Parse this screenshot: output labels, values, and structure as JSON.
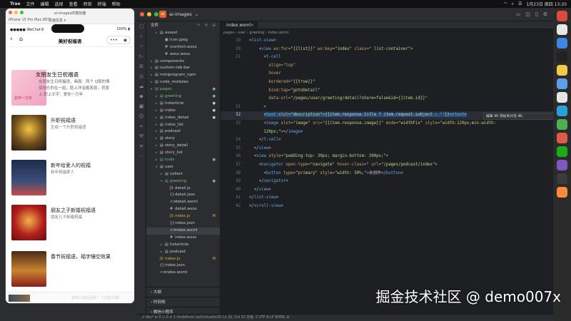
{
  "menubar": {
    "app_name": "Trae",
    "menus": [
      "文件",
      "编辑",
      "选择",
      "查看",
      "转到",
      "终端",
      "帮助"
    ],
    "clock": "1月23日 周四 13:20"
  },
  "simulator": {
    "window_title": "ai-images的模拟器",
    "device_label": "iPhone 15 Pro Max 85%",
    "tag_label": "页面信息 ▾",
    "carrier": "●●●●● WeChat令",
    "battery": "100% ▮",
    "nav_title": "美好祝福语",
    "capsule_dots": "•••",
    "capsule_circle": "◉",
    "hero": {
      "title": "女朋友生日祝福语",
      "desc_line1": "女朋友生日祝福语，画面：两个 Q版的情",
      "desc_line2": "侣快乐的在一起，脸上洋溢着笑容，背景",
      "desc_line3": "上 配上文字：爱你一万年",
      "thumb_text": "爱你一万年"
    },
    "cards": [
      {
        "title": "升职祝福语",
        "subtitle": "生成一个升职祝福语"
      },
      {
        "title": "新年给爱人的祝福",
        "subtitle": "新年祝福爱人"
      },
      {
        "title": "朋友之子新婚祝福语",
        "subtitle": "朋友儿子新婚祝福"
      },
      {
        "title": "春节祝福语，福字镶空效果",
        "subtitle": ""
      }
    ],
    "bottom_text": "送啥心流派武将！《斗笠江湖》"
  },
  "ide": {
    "project_name": "ai-images",
    "explorer_title": "文件",
    "tab_name": "index.wxml",
    "breadcrumb": "pages  ›  user  ›  greeting  ›  index.wxml",
    "footer_outline": "大纲",
    "footer_timeline": "时间线",
    "footer_mini": "微信小程序",
    "status": "⎇ dev*  ⊗ 0 ⚠ 0        ⊘ 1  Undefined (es5/cloud/es5)       Ln 32, Col 32   空格: 2   UTF-8   LF   WXML   ⚙",
    "popup_text": "编辑  ⌘I  添加到对话  ⌘L",
    "tree": [
      {
        "indent": 1,
        "arrow": "▸",
        "icon": "▤",
        "name": "assest",
        "flag": "",
        "cls": ""
      },
      {
        "indent": 2,
        "arrow": "",
        "icon": "▣",
        "name": "icon.jpeg",
        "flag": "",
        "cls": ""
      },
      {
        "indent": 2,
        "arrow": "",
        "icon": "#",
        "name": "iconfont.wxss",
        "flag": "",
        "cls": ""
      },
      {
        "indent": 2,
        "arrow": "",
        "icon": "#",
        "name": "weui.wxss",
        "flag": "",
        "cls": ""
      },
      {
        "indent": 0,
        "arrow": "▸",
        "icon": "▤",
        "name": "components",
        "flag": "",
        "cls": ""
      },
      {
        "indent": 0,
        "arrow": "▸",
        "icon": "▤",
        "name": "custom-tab-bar",
        "flag": "",
        "cls": ""
      },
      {
        "indent": 0,
        "arrow": "▸",
        "icon": "▤",
        "name": "miniprogram_npm",
        "flag": "",
        "cls": ""
      },
      {
        "indent": 0,
        "arrow": "▸",
        "icon": "▤",
        "name": "node_modules",
        "flag": "",
        "cls": ""
      },
      {
        "indent": 0,
        "arrow": "▾",
        "icon": "▤",
        "name": "pages",
        "flag": "●",
        "cls": "green"
      },
      {
        "indent": 1,
        "arrow": "▸",
        "icon": "▤",
        "name": "greeting",
        "flag": "●",
        "cls": "green"
      },
      {
        "indent": 1,
        "arrow": "▸",
        "icon": "▤",
        "name": "hotarticle",
        "flag": "●",
        "cls": ""
      },
      {
        "indent": 1,
        "arrow": "▸",
        "icon": "▤",
        "name": "index",
        "flag": "●",
        "cls": ""
      },
      {
        "indent": 1,
        "arrow": "▸",
        "icon": "▤",
        "name": "index_detail",
        "flag": "●",
        "cls": ""
      },
      {
        "indent": 1,
        "arrow": "▸",
        "icon": "▤",
        "name": "index_list",
        "flag": "",
        "cls": ""
      },
      {
        "indent": 1,
        "arrow": "▸",
        "icon": "▤",
        "name": "podcast",
        "flag": "",
        "cls": ""
      },
      {
        "indent": 1,
        "arrow": "▸",
        "icon": "▤",
        "name": "story",
        "flag": "",
        "cls": ""
      },
      {
        "indent": 1,
        "arrow": "▸",
        "icon": "▤",
        "name": "story_detail",
        "flag": "",
        "cls": ""
      },
      {
        "indent": 1,
        "arrow": "▸",
        "icon": "▤",
        "name": "story_list",
        "flag": "",
        "cls": ""
      },
      {
        "indent": 1,
        "arrow": "▸",
        "icon": "▤",
        "name": "tools",
        "flag": "●",
        "cls": "green"
      },
      {
        "indent": 1,
        "arrow": "▾",
        "icon": "▤",
        "name": "user",
        "flag": "",
        "cls": ""
      },
      {
        "indent": 2,
        "arrow": "▸",
        "icon": "▤",
        "name": "collect",
        "flag": "",
        "cls": ""
      },
      {
        "indent": 2,
        "arrow": "▾",
        "icon": "▤",
        "name": "greeting",
        "flag": "●",
        "cls": "green"
      },
      {
        "indent": 3,
        "arrow": "",
        "icon": "JS",
        "name": "detail.js",
        "flag": "",
        "cls": ""
      },
      {
        "indent": 3,
        "arrow": "",
        "icon": "{}",
        "name": "detail.json",
        "flag": "",
        "cls": ""
      },
      {
        "indent": 3,
        "arrow": "",
        "icon": "<>",
        "name": "detail.wxml",
        "flag": "",
        "cls": ""
      },
      {
        "indent": 3,
        "arrow": "",
        "icon": "#",
        "name": "detail.wxss",
        "flag": "",
        "cls": ""
      },
      {
        "indent": 3,
        "arrow": "",
        "icon": "JS",
        "name": "index.js",
        "flag": "M",
        "cls": "yellow"
      },
      {
        "indent": 3,
        "arrow": "",
        "icon": "{}",
        "name": "index.json",
        "flag": "",
        "cls": ""
      },
      {
        "indent": 3,
        "arrow": "",
        "icon": "<>",
        "name": "index.wxml",
        "flag": "",
        "cls": "sel"
      },
      {
        "indent": 3,
        "arrow": "",
        "icon": "#",
        "name": "index.wxss",
        "flag": "",
        "cls": ""
      },
      {
        "indent": 2,
        "arrow": "▸",
        "icon": "▤",
        "name": "hotarticle",
        "flag": "",
        "cls": ""
      },
      {
        "indent": 2,
        "arrow": "▸",
        "icon": "▤",
        "name": "podcast",
        "flag": "",
        "cls": ""
      },
      {
        "indent": 1,
        "arrow": "",
        "icon": "JS",
        "name": "index.js",
        "flag": "M",
        "cls": "yellow"
      },
      {
        "indent": 1,
        "arrow": "",
        "icon": "{}",
        "name": "index.json",
        "flag": "",
        "cls": ""
      },
      {
        "indent": 1,
        "arrow": "",
        "icon": "<>",
        "name": "index.wxml",
        "flag": "",
        "cls": ""
      }
    ],
    "code": [
      {
        "n": "19",
        "html": "<span class='punc'>&lt;</span><span class='tag'>list-view</span><span class='punc'>&gt;</span>"
      },
      {
        "n": "20",
        "html": "    <span class='punc'>&lt;</span><span class='tag'>view</span> <span class='attr'>wx:for</span><span class='punc'>=</span><span class='str'>\"{{list}}\"</span> <span class='attr'>wx:key</span><span class='punc'>=</span><span class='str'>\"index\"</span> <span class='attr'>class</span><span class='punc'>=</span><span class='str'>\" list-container\"</span><span class='punc'>&gt;</span>"
      },
      {
        "n": "21",
        "html": "      <span class='punc'>&lt;</span><span class='tag'>t-cell</span>"
      },
      {
        "n": "",
        "html": "        <span class='attr'>align=\"top\"</span>"
      },
      {
        "n": "",
        "html": "        <span class='attr'>hover</span>"
      },
      {
        "n": "",
        "html": "        <span class='attr'>bordered</span><span class='punc'>=</span><span class='str'>\"{{true}}\"</span>"
      },
      {
        "n": "",
        "html": "        <span class='attr'>bind:tap</span><span class='punc'>=</span><span class='str'>\"gotoDetail\"</span>"
      },
      {
        "n": "",
        "html": "        <span class='attr'>data-url</span><span class='punc'>=</span><span class='str'>\"/pages/user/greeting/detail?share=false&amp;id={{item.id}}\"</span>"
      },
      {
        "n": "31",
        "html": "      <span class='punc'>&gt;</span>"
      },
      {
        "n": "32",
        "html": "      <span class='sel-bg'><span class='punc'>&lt;</span><span class='tag'>text</span> <span class='attr'>slot</span><span class='punc'>=</span><span class='str'>\"description\"</span><span class='punc'>&gt;</span><span class='txt'>{{item.response.title ? item.request.subject : ''}}</span><span class='punc'>&lt;/</span><span class='tag'>text</span><span class='punc'>&gt;</span></span>"
      },
      {
        "n": "33",
        "html": "      <span class='punc'>&lt;</span><span class='tag'>image</span> <span class='attr'>slot</span><span class='punc'>=</span><span class='str'>\"image\"</span> <span class='attr'>src</span><span class='punc'>=</span><span class='str'>\"{{item.response.image}}\"</span> <span class='attr'>mode</span><span class='punc'>=</span><span class='str'>\"widthFix\"</span> <span class='attr'>style</span><span class='punc'>=</span><span class='str'>\"width:120px;min-width:</span>"
      },
      {
        "n": "",
        "html": "      <span class='str'>120px;\"</span><span class='punc'>&gt;&lt;/</span><span class='tag'>image</span><span class='punc'>&gt;</span>"
      },
      {
        "n": "34",
        "html": "    <span class='punc'>&lt;/</span><span class='tag'>t-cell</span><span class='punc'>&gt;</span>"
      },
      {
        "n": "35",
        "html": "  <span class='punc'>&lt;/</span><span class='tag'>view</span><span class='punc'>&gt;</span>"
      },
      {
        "n": "36",
        "html": "  <span class='punc'>&lt;</span><span class='tag'>view</span> <span class='attr'>style</span><span class='punc'>=</span><span class='str'>\"padding-top: 30px; margin-bottom: 200px;\"</span><span class='punc'>&gt;</span>"
      },
      {
        "n": "37",
        "html": "    <span class='punc'>&lt;</span><span class='tag'>navigator</span> <span class='attr'>open-type</span><span class='punc'>=</span><span class='str'>\"navigate\"</span> <span class='attr'>hover-class</span><span class='punc'>=</span><span class='str'>\"</span> <span class='attr'>url</span><span class='punc'>=</span><span class='str'>\"/pages/podcast/index\"</span><span class='punc'>&gt;</span>"
      },
      {
        "n": "38",
        "html": "      <span class='punc'>&lt;</span><span class='tag'>button</span> <span class='attr'>type</span><span class='punc'>=</span><span class='str'>\"primary\"</span> <span class='attr'>style</span><span class='punc'>=</span><span class='str'>\"width: 50%;\"</span><span class='punc'>&gt;</span><span class='txt'>去创作</span><span class='punc'>&lt;/</span><span class='tag'>button</span><span class='punc'>&gt;</span>"
      },
      {
        "n": "39",
        "html": "    <span class='punc'>&lt;/</span><span class='tag'>navigator</span><span class='punc'>&gt;</span>"
      },
      {
        "n": "40",
        "html": "  <span class='punc'>&lt;/</span><span class='tag'>view</span><span class='punc'>&gt;</span>"
      },
      {
        "n": "41",
        "html": "<span class='punc'>&lt;/</span><span class='tag'>list-view</span><span class='punc'>&gt;</span>"
      },
      {
        "n": "42",
        "html": "<span class='punc'>&lt;/</span><span class='tag'>scroll-view</span><span class='punc'>&gt;</span>"
      }
    ]
  },
  "watermark": "掘金技术社区 @ demo007x"
}
